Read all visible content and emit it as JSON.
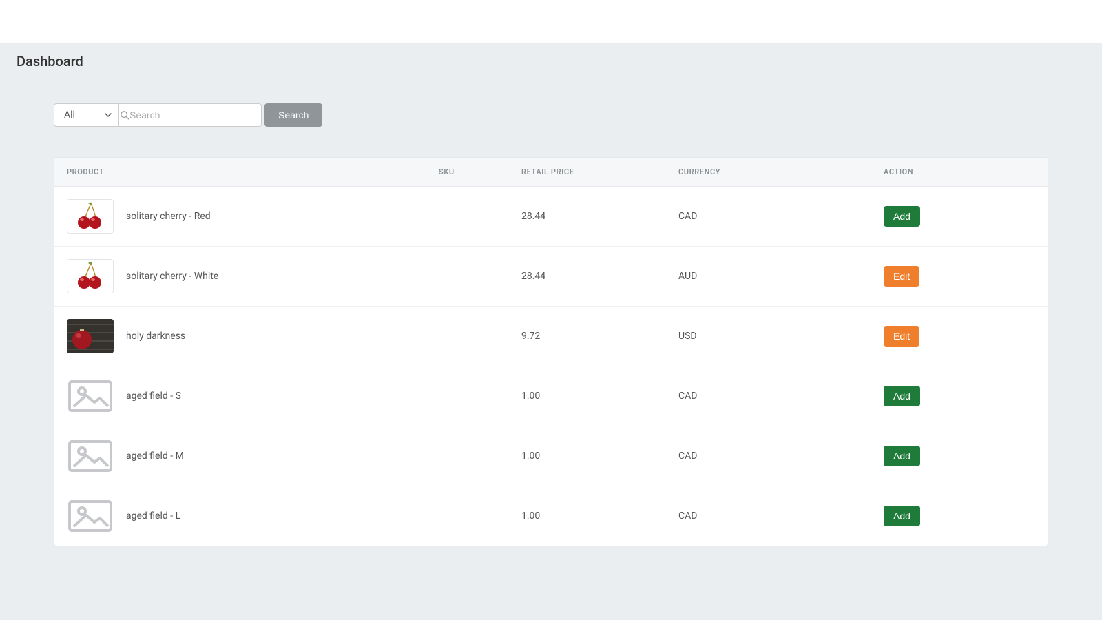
{
  "header": {
    "title": "Dashboard"
  },
  "filter": {
    "selected": "All",
    "search_placeholder": "Search",
    "search_value": "",
    "search_button": "Search"
  },
  "columns": {
    "product": "Product",
    "sku": "SKU",
    "retail": "Retail Price",
    "currency": "Currency",
    "action": "Action"
  },
  "actions": {
    "add": "Add",
    "edit": "Edit"
  },
  "rows": [
    {
      "name": "solitary cherry - Red",
      "sku": "",
      "price": "28.44",
      "currency": "CAD",
      "action": "add",
      "thumb": "cherry"
    },
    {
      "name": "solitary cherry - White",
      "sku": "",
      "price": "28.44",
      "currency": "AUD",
      "action": "edit",
      "thumb": "cherry"
    },
    {
      "name": "holy darkness",
      "sku": "",
      "price": "9.72",
      "currency": "USD",
      "action": "edit",
      "thumb": "ornament"
    },
    {
      "name": "aged field - S",
      "sku": "",
      "price": "1.00",
      "currency": "CAD",
      "action": "add",
      "thumb": "placeholder"
    },
    {
      "name": "aged field - M",
      "sku": "",
      "price": "1.00",
      "currency": "CAD",
      "action": "add",
      "thumb": "placeholder"
    },
    {
      "name": "aged field - L",
      "sku": "",
      "price": "1.00",
      "currency": "CAD",
      "action": "add",
      "thumb": "placeholder"
    }
  ]
}
